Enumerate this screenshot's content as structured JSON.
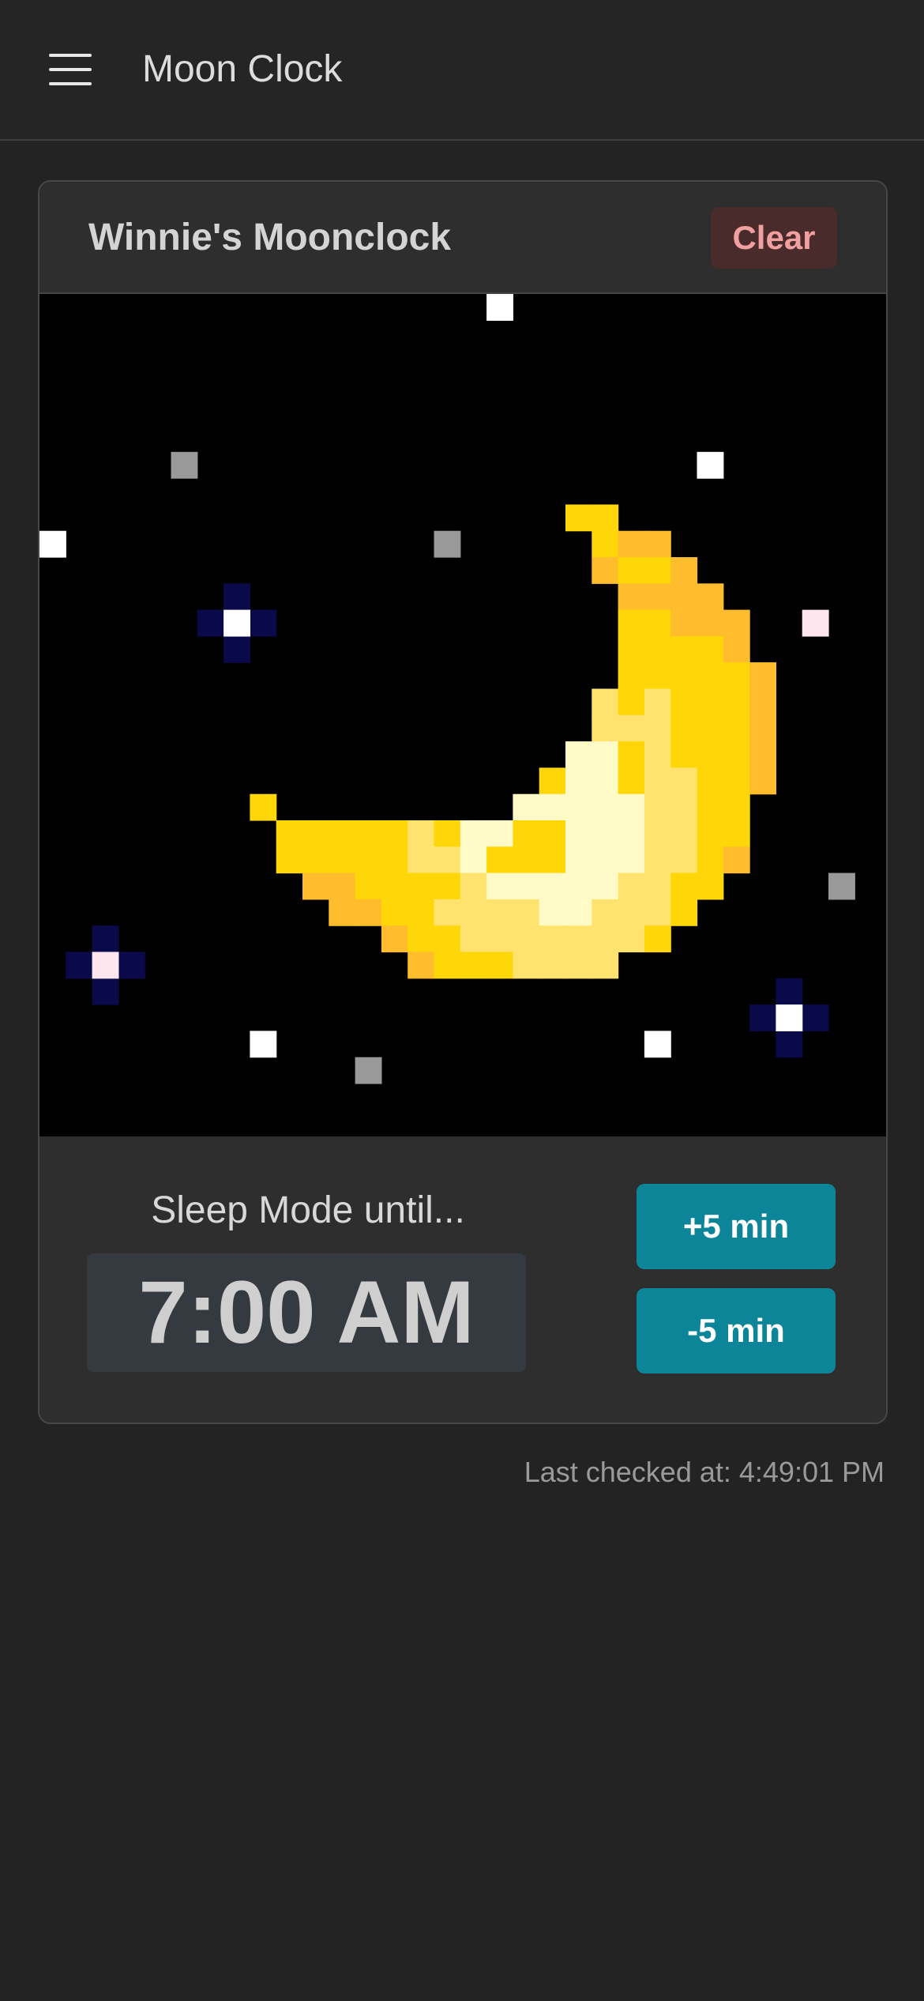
{
  "navbar": {
    "title": "Moon Clock",
    "menu_icon": "hamburger-menu-icon"
  },
  "card": {
    "title": "Winnie's Moonclock",
    "clear_label": "Clear"
  },
  "display": {
    "description": "pixel-art crescent moon with stars on black background",
    "colors": {
      "moon_dark": "#FFBC2C",
      "moon_mid": "#FFD708",
      "moon_light": "#FFE36E",
      "moon_highlight": "#FFFBC8",
      "star_white": "#FFFFFF",
      "star_gray": "#999999",
      "star_glow": "#0A0A4A",
      "star_pink": "#FFE6EE"
    }
  },
  "sleep": {
    "label": "Sleep Mode until...",
    "time": "7:00 AM",
    "plus_label": "+5 min",
    "minus_label": "-5 min"
  },
  "status": {
    "last_checked": "Last checked at: 4:49:01 PM"
  }
}
